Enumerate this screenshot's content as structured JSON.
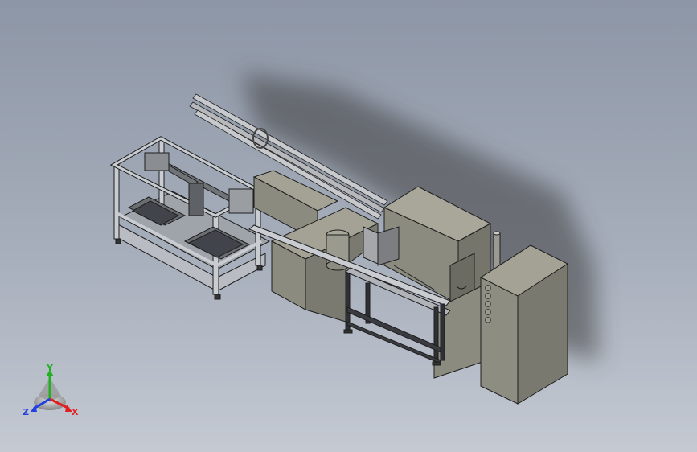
{
  "viewport": {
    "background_top": "#8d96a6",
    "background_bottom": "#c4c9d2"
  },
  "model": {
    "body_color": "#8c8b80",
    "frame_color": "#c9ccd1",
    "edge_color": "#1e1e1e"
  },
  "triad": {
    "y_label": "Y",
    "x_label": "X",
    "z_label": "Z",
    "x_color": "#e02020",
    "y_color": "#20b020",
    "z_color": "#2040e0"
  }
}
